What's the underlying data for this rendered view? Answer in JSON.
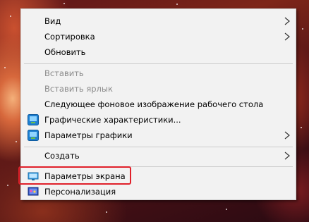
{
  "context_menu": {
    "items": [
      {
        "label": "Вид",
        "disabled": false,
        "submenu": true,
        "icon": ""
      },
      {
        "label": "Сортировка",
        "disabled": false,
        "submenu": true,
        "icon": ""
      },
      {
        "label": "Обновить",
        "disabled": false,
        "submenu": false,
        "icon": ""
      },
      {
        "label": "Вставить",
        "disabled": true,
        "submenu": false,
        "icon": ""
      },
      {
        "label": "Вставить ярлык",
        "disabled": true,
        "submenu": false,
        "icon": ""
      },
      {
        "label": "Следующее фоновое изображение рабочего стола",
        "disabled": false,
        "submenu": false,
        "icon": ""
      },
      {
        "label": "Графические характеристики...",
        "disabled": false,
        "submenu": false,
        "icon": "intel-graphics-icon"
      },
      {
        "label": "Параметры графики",
        "disabled": false,
        "submenu": true,
        "icon": "intel-graphics-icon"
      },
      {
        "label": "Создать",
        "disabled": false,
        "submenu": true,
        "icon": ""
      },
      {
        "label": "Параметры экрана",
        "disabled": false,
        "submenu": false,
        "icon": "display-monitor-icon"
      },
      {
        "label": "Персонализация",
        "disabled": false,
        "submenu": false,
        "icon": "personalization-icon"
      }
    ]
  },
  "colors": {
    "menu_background": "#f2f2f2",
    "disabled_text": "#8a8a8a",
    "highlight_border": "#e0202a",
    "separator": "#cccccc"
  }
}
